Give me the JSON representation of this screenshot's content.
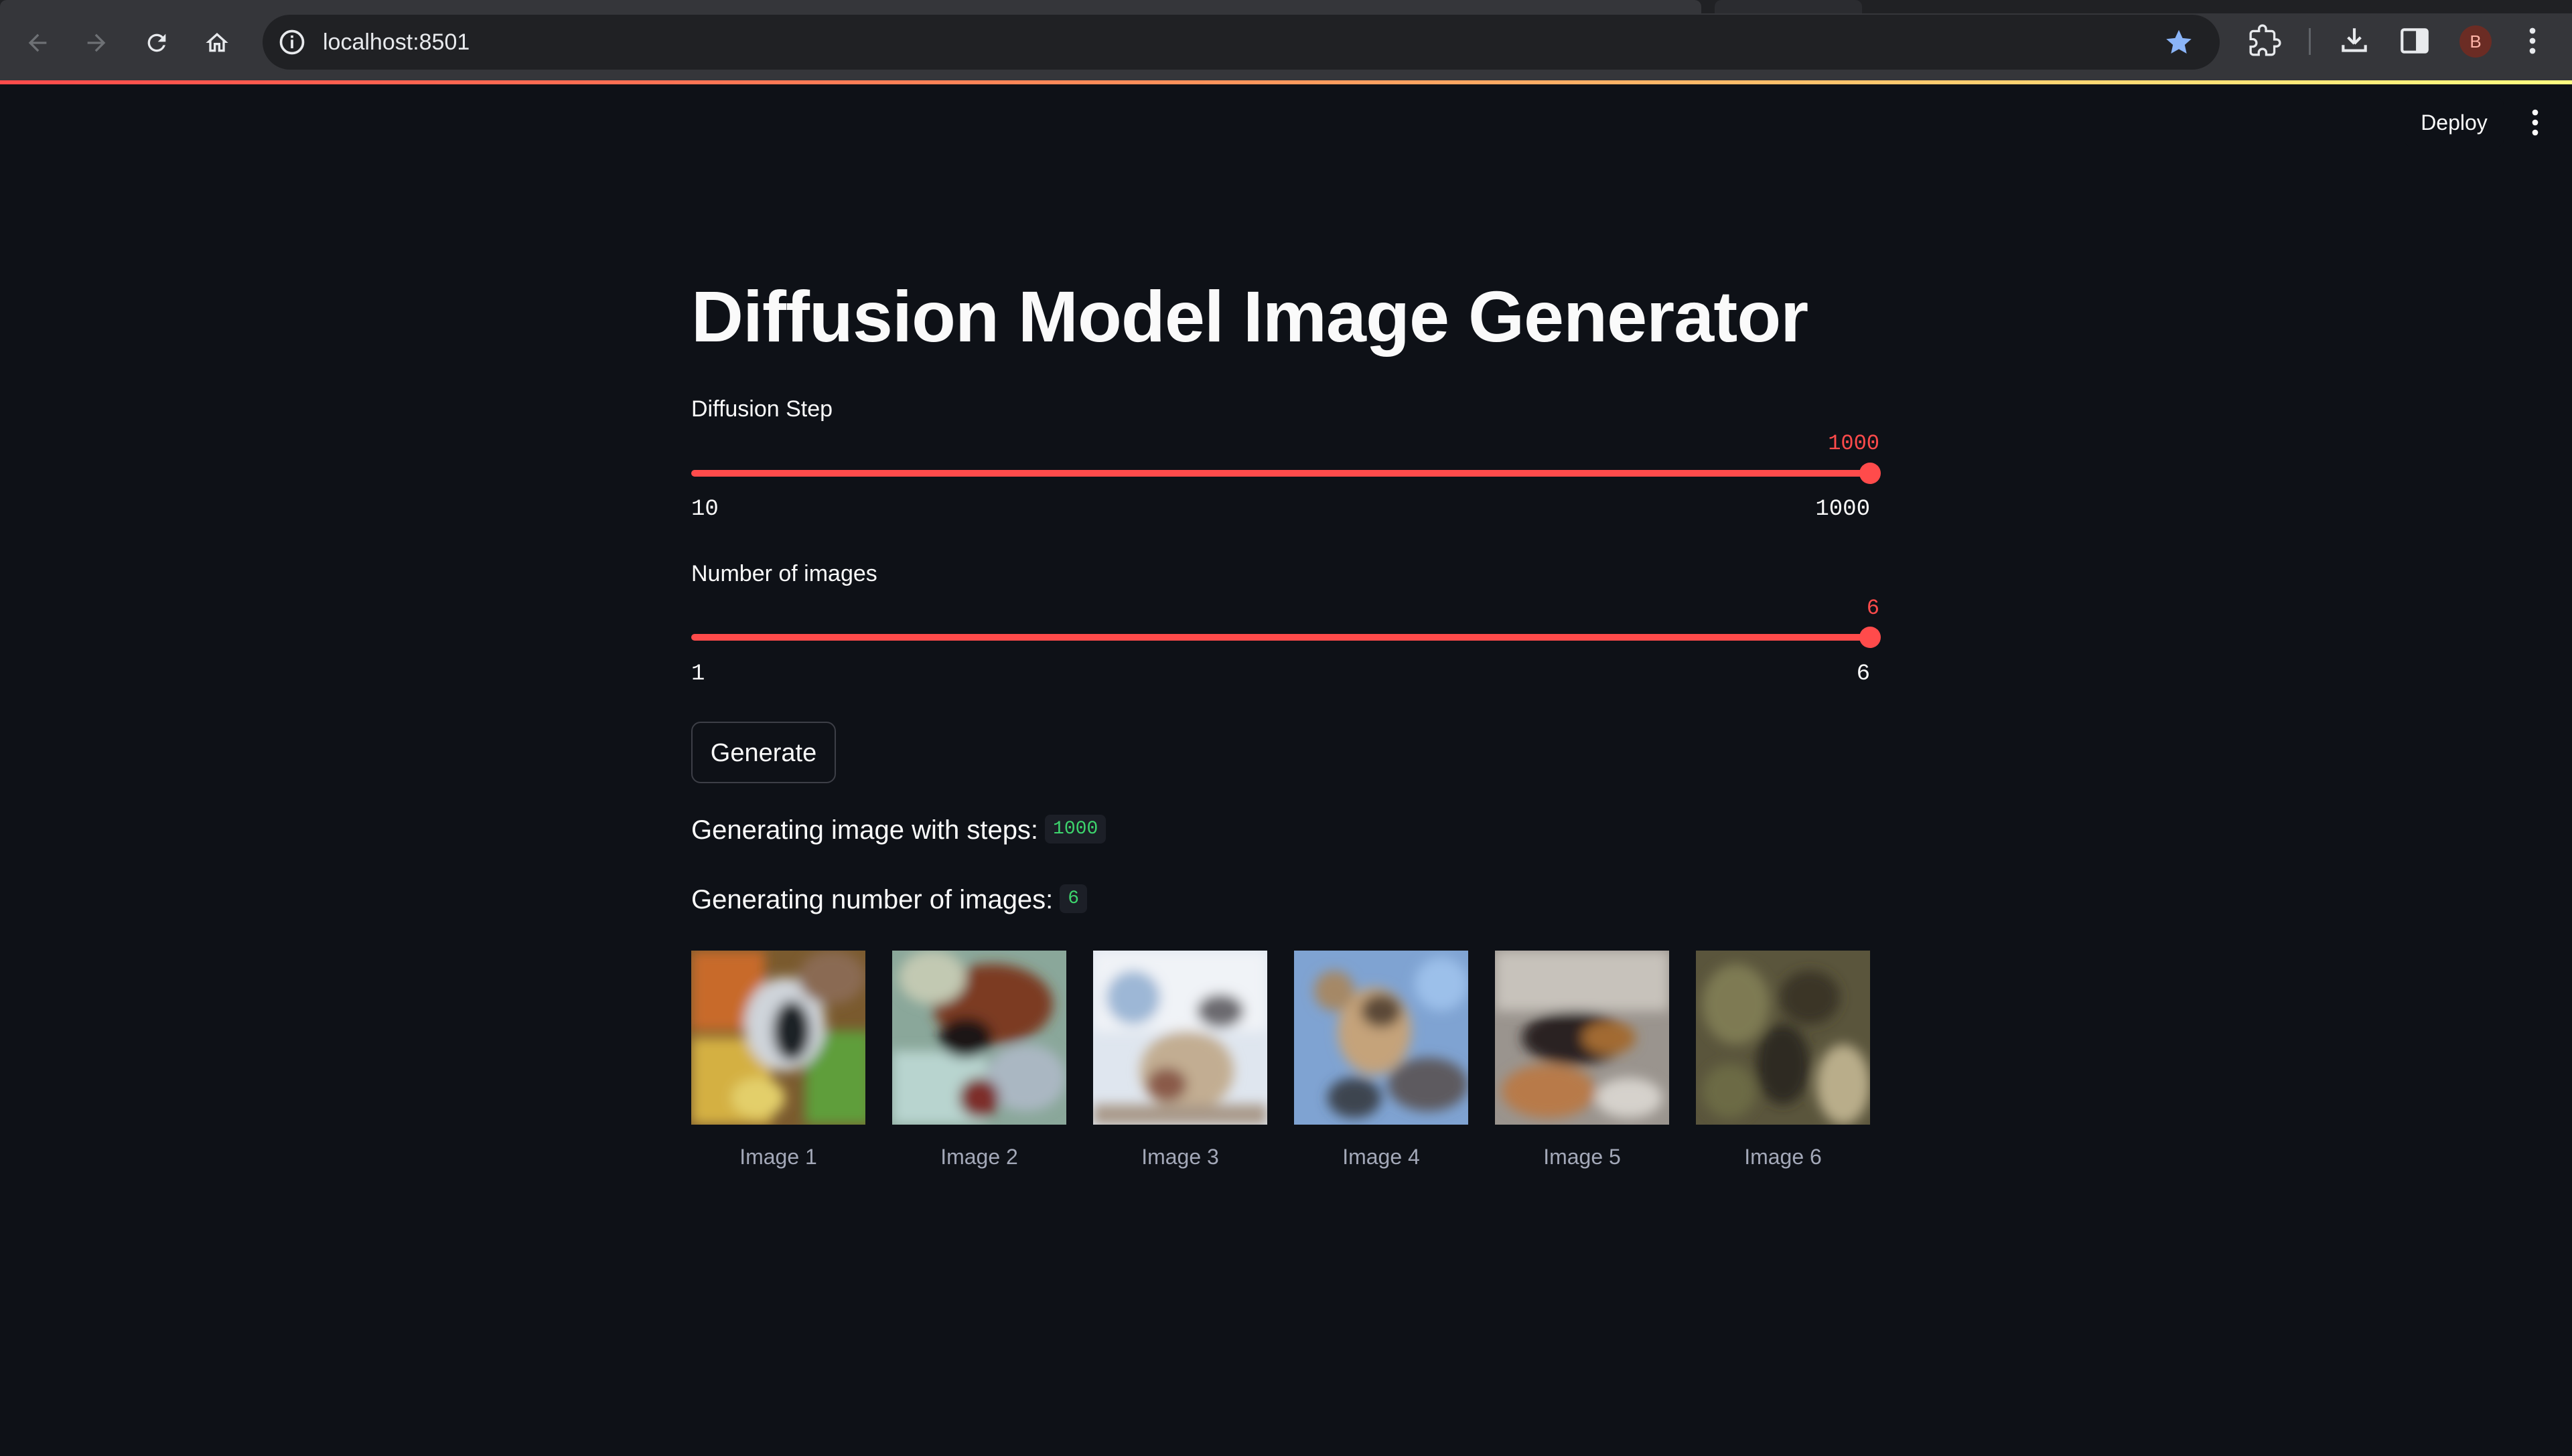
{
  "browser": {
    "url": "localhost:8501",
    "avatar_initial": "B"
  },
  "header": {
    "deploy_label": "Deploy"
  },
  "app": {
    "title": "Diffusion Model Image Generator",
    "slider_steps": {
      "label": "Diffusion Step",
      "value": "1000",
      "min": "10",
      "max": "1000",
      "fraction": 1.0
    },
    "slider_images": {
      "label": "Number of images",
      "value": "6",
      "min": "1",
      "max": "6",
      "fraction": 1.0
    },
    "generate_label": "Generate",
    "info_steps": {
      "text": "Generating image with steps:",
      "value": "1000"
    },
    "info_count": {
      "text": "Generating number of images:",
      "value": "6"
    },
    "images": [
      {
        "caption": "Image 1"
      },
      {
        "caption": "Image 2"
      },
      {
        "caption": "Image 3"
      },
      {
        "caption": "Image 4"
      },
      {
        "caption": "Image 5"
      },
      {
        "caption": "Image 6"
      }
    ]
  },
  "colors": {
    "background": "#0e1117",
    "accent": "#ff4b4b",
    "code_text": "#3dd56d",
    "caption_text": "#a3a8b8"
  }
}
